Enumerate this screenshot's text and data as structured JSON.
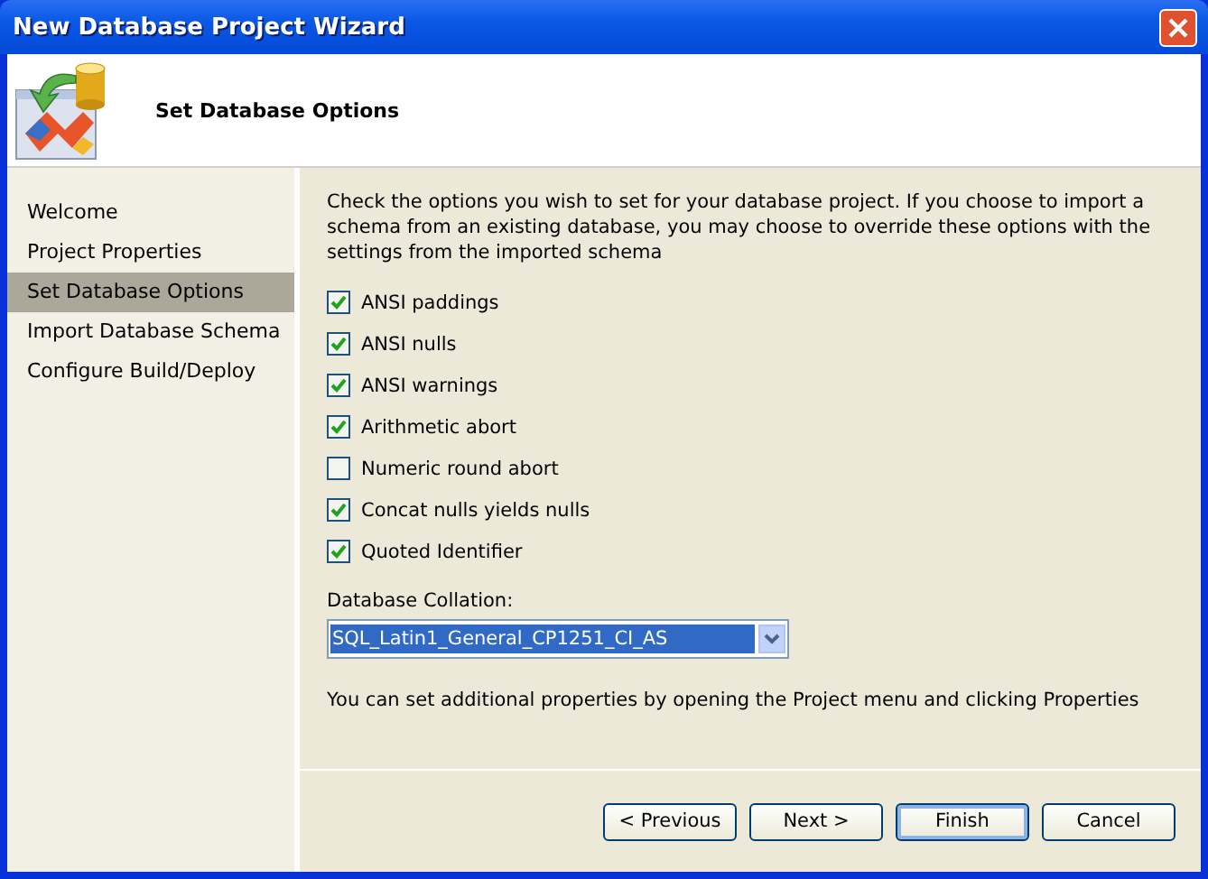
{
  "window": {
    "title": "New Database Project Wizard"
  },
  "header": {
    "title": "Set Database Options"
  },
  "sidebar": {
    "items": [
      {
        "label": "Welcome",
        "selected": false
      },
      {
        "label": "Project Properties",
        "selected": false
      },
      {
        "label": "Set Database Options",
        "selected": true
      },
      {
        "label": "Import Database Schema",
        "selected": false
      },
      {
        "label": "Configure Build/Deploy",
        "selected": false
      }
    ]
  },
  "description": "Check the options you wish to set for your database project. If you choose to import a schema from an existing database, you may choose to override these options with the settings from the imported schema",
  "options": [
    {
      "label": "ANSI paddings",
      "checked": true
    },
    {
      "label": "ANSI nulls",
      "checked": true
    },
    {
      "label": "ANSI warnings",
      "checked": true
    },
    {
      "label": "Arithmetic abort",
      "checked": true
    },
    {
      "label": "Numeric round abort",
      "checked": false
    },
    {
      "label": "Concat nulls yields nulls",
      "checked": true
    },
    {
      "label": "Quoted Identifier",
      "checked": true
    }
  ],
  "collation": {
    "label": "Database Collation:",
    "value": "SQL_Latin1_General_CP1251_CI_AS"
  },
  "note": "You can set additional properties by opening the Project menu and clicking Properties",
  "buttons": [
    {
      "label": "< Previous",
      "default": false
    },
    {
      "label": "Next >",
      "default": false
    },
    {
      "label": "Finish",
      "default": true
    },
    {
      "label": "Cancel",
      "default": false
    }
  ]
}
